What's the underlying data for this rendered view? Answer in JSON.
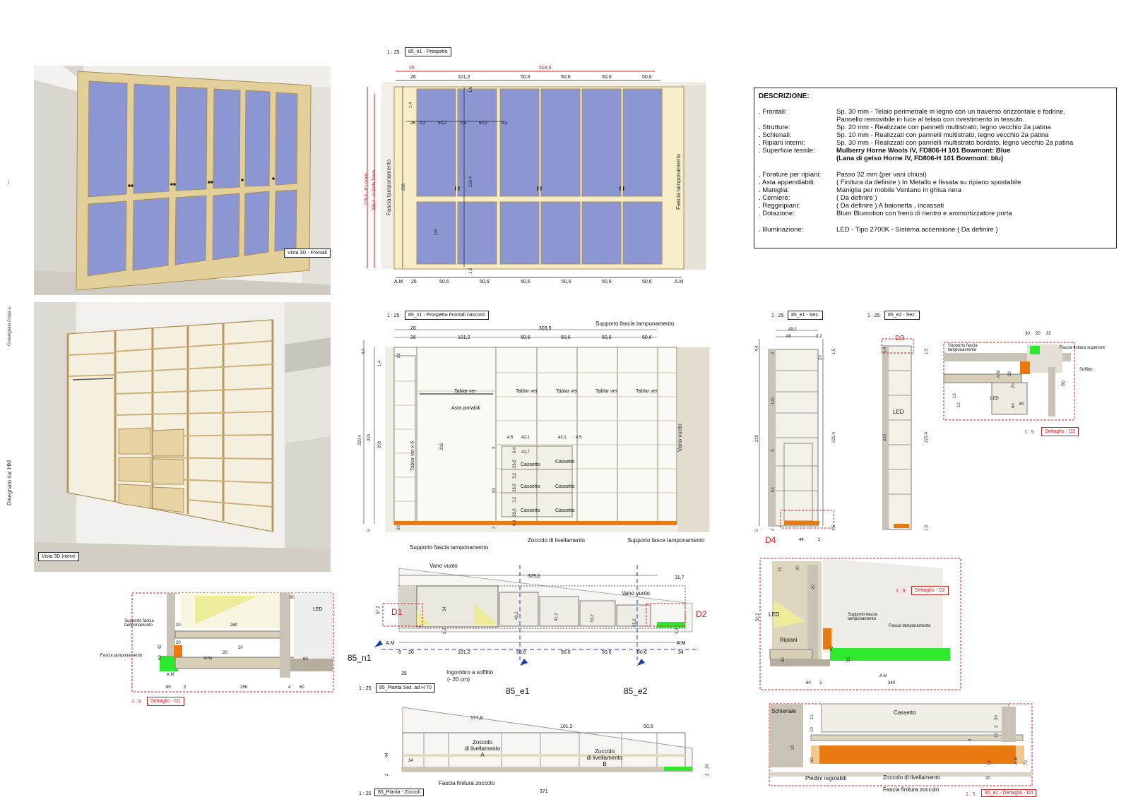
{
  "margin": {
    "drawn_by": "Disegnato da:  HM",
    "delivered_copy": "Consegnata Copia a:",
    "mark": "i"
  },
  "views": {
    "v3d_front": "Vista 3D - Frontali",
    "v3d_interior": "Vista 3D Interni",
    "elev_scale": "1 : 25",
    "elev_tag": "85_n1 - Prospetto",
    "hidden_scale": "1 : 25",
    "hidden_tag": "85_n1 - Prospetto Frontali nascosti",
    "e1_scale": "1 : 25",
    "e1_tag": "85_e1 - Sez.",
    "e2_scale": "1 : 25",
    "e2_tag": "85_e2 - Sez.",
    "plan_scale": "1 : 25",
    "plan_tag": "85_Pianta Sez. ad H 70",
    "zoccoli_scale": "1 : 25",
    "zoccoli_tag": "85_Pianta - Zoccoli",
    "d1_scale": "1 : 5",
    "d1_tag": "Dettaglio - D1",
    "d2_scale": "1 : 5",
    "d2_tag": "Dettaglio - D2",
    "d3_scale": "1 : 5",
    "d3_tag": "Dettaglio - D3",
    "d4_scale": "1 : 5",
    "d4_tag": "85_e1 - Dettaglio - D4"
  },
  "description": {
    "title": "DESCRIZIONE:",
    "rows": [
      {
        "k": ". Frontali:",
        "v": "Sp. 30 mm - Telaio perimetrale in legno con un traverso orizzontale e fodrine."
      },
      {
        "k": "",
        "v": "Pannello removibile in luce al telaio con rivestimento in tessuto."
      },
      {
        "k": ". Strutture:",
        "v": "Sp. 20 mm - Realizzate con pannelli multistrato, legno vecchio 2a patina"
      },
      {
        "k": ". Schienali:",
        "v": "Sp. 10 mm - Realizzati con pannelli multistrato, legno vecchio 2a patina"
      },
      {
        "k": ". Ripiani interni:",
        "v": "Sp. 30 mm - Realizzati con pannelli multistrato bordato, legno vecchio 2a patina"
      },
      {
        "k": ". Superficie tessile:",
        "v": "Mulberry Horne Wools IV, FD806-H 101 Bowmont: Blue"
      },
      {
        "k": "",
        "v": "(Lana di gelso Horne IV, FD806-H 101 Bowmont: blu)"
      },
      {
        "k": ". Forature per ripiani:",
        "v": "Passo 32 mm (per vani chiusi)"
      },
      {
        "k": ". Asta appendiabiti:",
        "v": "( Finitura da definire ) In Metallo e fissata su ripiano spostabile"
      },
      {
        "k": ". Maniglia:",
        "v": "Maniglia per mobile Ventano in ghisa nera"
      },
      {
        "k": ". Cerniere:",
        "v": "( Da definire )"
      },
      {
        "k": ". Reggiripiani:",
        "v": "( Da definire ) A baionetta , incassati"
      },
      {
        "k": ". Dotazione:",
        "v": "Blum Blumotion con freno di rientro e ammortizzatore porta"
      },
      {
        "k": ". Illuminazione:",
        "v": "LED - Tipo 2700K - Sistema accensione ( Da definire )"
      }
    ]
  },
  "elevation": {
    "dim_top_red": "303,6",
    "dim_top_red_left": "26",
    "dim_top": [
      "26",
      "101,2",
      "50,6",
      "50,6",
      "50,6",
      "50,6"
    ],
    "dim_bottom": [
      "A.M",
      "26",
      "50,6",
      "50,6",
      "50,6",
      "50,6",
      "50,6",
      "50,6",
      "A.M"
    ],
    "inner": [
      "26",
      "0,2",
      "50,2",
      "0,4",
      "50,2",
      "0,4",
      "1,4",
      "1,6",
      "1,5",
      "208",
      "226,4",
      "100"
    ],
    "h_locale": "229,4 - H Locale",
    "h_trave": "226,4 - H Sotto Trave",
    "fascia_left": "Fascia tamponamento",
    "fascia_right": "Fascia tamponamento"
  },
  "hidden": {
    "supporto_top": "Supporto fascia tamponamento",
    "dim_top": [
      "26",
      "303,6"
    ],
    "dim_row": [
      "26",
      "101,2",
      "50,6",
      "50,6",
      "50,6",
      "50,6"
    ],
    "tablar": [
      "Tablar ver",
      "Tablar ver",
      "Tablar ver",
      "Tablar ver",
      "Tablar ver"
    ],
    "asta": "Asta portabiti",
    "tablar_side": "Tablar ver x 6",
    "cassetti": [
      "Cassetto",
      "Cassetto",
      "Cassetto",
      "Cassetto",
      "Cassetto",
      "Cassetto"
    ],
    "drawer_dims": [
      "4,5",
      "42,1",
      "42,1",
      "4,5",
      "41,7",
      "0,4",
      "28,6",
      "3,2",
      "28,6",
      "3,2",
      "28,6",
      "0,4",
      "3",
      "83"
    ],
    "vertical_dims": [
      "4,4",
      "1,4",
      "229,4",
      "220",
      "203",
      "216",
      "5",
      "2",
      "20",
      "20"
    ],
    "vano_vuoto": "Vano vuoto",
    "supporto_bottom_left": "Supporto fascia tamponamento",
    "zoccolo": "Zoccolo di livellamento",
    "supporto_bottom_right": "Supporto fasce tamponamento"
  },
  "section_e1": {
    "top_dims": [
      "49,2",
      "46",
      "3,2"
    ],
    "side_dims": [
      "4,4",
      "1,5",
      "2",
      "120",
      "3",
      "220",
      "93",
      "5",
      "2",
      "229,4",
      "1,5",
      "44",
      "2",
      "20"
    ],
    "d4": "D4"
  },
  "section_e2": {
    "d3": "D3",
    "led": "LED",
    "dims": [
      "1,4",
      "1,5",
      "220",
      "229,4",
      "1,5"
    ]
  },
  "detail_d3": {
    "labels": [
      "Supporto fascia tamponamento",
      "Fascia finitura superiore",
      "Soffitto",
      "LED"
    ],
    "dims": [
      "30",
      "20",
      "32",
      "A.M",
      "30",
      "60",
      "10",
      "10",
      "20",
      "60",
      "80"
    ]
  },
  "detail_d1": {
    "labels": [
      "Supporto fascia tamponamento",
      "Fascia tamponamento",
      "LED",
      "Anta",
      "A.M"
    ],
    "dims": [
      "20",
      "260",
      "60",
      "20",
      "40",
      "60",
      "20",
      "20",
      "60",
      "2",
      "256",
      "4",
      "60",
      "80"
    ]
  },
  "plan": {
    "vano_top": "Vano vuoto",
    "vano_right": "Vano vuoto",
    "dim_top": "329,6",
    "dim_right": "31,7",
    "inner": [
      "57,2",
      "54",
      "49,2",
      "41,2",
      "33,2",
      "25,2",
      "3,2",
      "3,2"
    ],
    "bottom": [
      "A.M",
      "6",
      "26",
      "101,2",
      "50,6",
      "50,6",
      "50,6",
      "50,6",
      "A.M",
      "34"
    ],
    "d1": "D1",
    "d2": "D2",
    "n1": "85_n1",
    "e1": "85_e1",
    "e2": "85_e2",
    "ingombro": "Ingombro a soffitto",
    "ingombro2": "(- 20 cm)",
    "dim25": "25"
  },
  "detail_d2": {
    "labels": [
      "LED",
      "Supporto fascia tamponamento",
      "Fascia tamponamento",
      "Ripiani",
      "A.M"
    ],
    "dims": [
      "10",
      "20",
      "20",
      "52,2",
      "40",
      "30",
      "30",
      "60",
      "2",
      "340"
    ]
  },
  "zoccoli": {
    "dims": [
      "177,6",
      "101,2",
      "50,6",
      "44",
      "34",
      "2",
      "20",
      "2",
      "371"
    ],
    "zoccolo_a": [
      "Zoccolo",
      "di livellamento",
      "A"
    ],
    "zoccolo_b": [
      "Zoccolo",
      "di livellamento",
      "B"
    ],
    "fascia": "Fascia finitura zoccolo"
  },
  "detail_d4": {
    "labels": [
      "Schienale",
      "Cassetto",
      "Piedini regolabili",
      "Zoccolo di livellamento",
      "Fascia finitura zoccolo"
    ],
    "dims": [
      "10",
      "20",
      "10",
      "60",
      "3",
      "20",
      "3",
      "10",
      "A.M",
      "70",
      "15",
      "20"
    ]
  },
  "colors": {
    "wood": "#e3cf9a",
    "wood_dark": "#bfa56a",
    "fabric": "#8b96d2",
    "red": "#d42020",
    "green": "#2ee82e",
    "orange": "#e87a10",
    "wall": "#e4e0d8"
  }
}
